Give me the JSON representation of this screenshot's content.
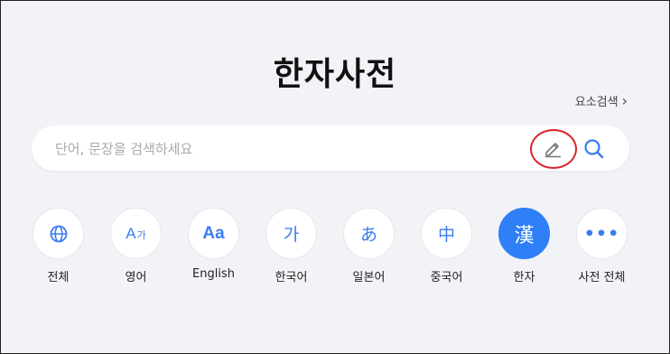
{
  "page": {
    "title": "한자사전"
  },
  "element_search": {
    "label": "요소검색",
    "chevron": "›",
    "icon": "chevron-right-icon"
  },
  "search": {
    "placeholder": "단어, 문장을 검색하세요",
    "handwrite_icon": "pencil-icon",
    "search_icon": "search-icon",
    "highlight_color": "#d9232b"
  },
  "categories": [
    {
      "label": "전체",
      "icon": "globe-icon",
      "glyph": ""
    },
    {
      "label": "영어",
      "icon": "english-icon",
      "glyph_big": "A",
      "glyph_small": "가"
    },
    {
      "label": "English",
      "icon": "english-english-icon",
      "glyph": "Aa"
    },
    {
      "label": "한국어",
      "icon": "korean-icon",
      "glyph": "가"
    },
    {
      "label": "일본어",
      "icon": "japanese-icon",
      "glyph": "あ"
    },
    {
      "label": "중국어",
      "icon": "chinese-icon",
      "glyph": "中"
    },
    {
      "label": "한자",
      "icon": "hanja-icon",
      "glyph": "漢",
      "active": true
    },
    {
      "label": "사전 전체",
      "icon": "more-icon",
      "glyph": "•••"
    }
  ],
  "colors": {
    "accent": "#2f7ff6",
    "background": "#f2f3f7"
  }
}
